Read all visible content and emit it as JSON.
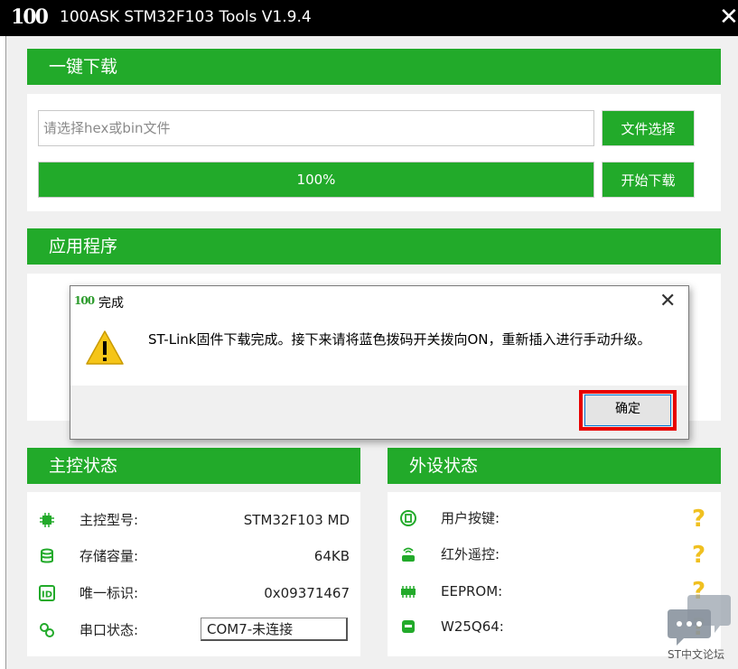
{
  "window": {
    "logo_text": "100",
    "title": "100ASK STM32F103 Tools V1.9.4",
    "close_glyph": "✕"
  },
  "download": {
    "header": "一键下载",
    "file_placeholder": "请选择hex或bin文件",
    "file_value": "",
    "choose_file_label": "文件选择",
    "start_download_label": "开始下载",
    "progress_percent": 100,
    "progress_text": "100%"
  },
  "app_program": {
    "header": "应用程序"
  },
  "main_status": {
    "header": "主控状态",
    "rows": [
      {
        "icon": "chip-icon",
        "label": "主控型号:",
        "value": "STM32F103 MD"
      },
      {
        "icon": "database-icon",
        "label": "存储容量:",
        "value": "64KB"
      },
      {
        "icon": "id-card-icon",
        "label": "唯一标识:",
        "value": "0x09371467"
      },
      {
        "icon": "link-icon",
        "label": "串口状态:",
        "value": "COM7-未连接"
      }
    ]
  },
  "peripheral_status": {
    "header": "外设状态",
    "rows": [
      {
        "icon": "button-icon",
        "label": "用户按键:",
        "value": "?"
      },
      {
        "icon": "infrared-icon",
        "label": "红外遥控:",
        "value": "?"
      },
      {
        "icon": "memory-chip-icon",
        "label": "EEPROM:",
        "value": "?"
      },
      {
        "icon": "flash-drive-icon",
        "label": "W25Q64:",
        "value": "?"
      }
    ]
  },
  "dialog": {
    "logo_text": "100",
    "title": "完成",
    "close_glyph": "✕",
    "icon": "warning-icon",
    "message": "ST-Link固件下载完成。接下来请将蓝色拨码开关拨向ON，重新插入进行手动升级。",
    "ok_label": "确定"
  },
  "watermark": {
    "text": "ST中文论坛"
  },
  "colors": {
    "accent_green": "#22aa2a",
    "highlight_red": "#e80000",
    "warning_yellow": "#f0c020"
  }
}
